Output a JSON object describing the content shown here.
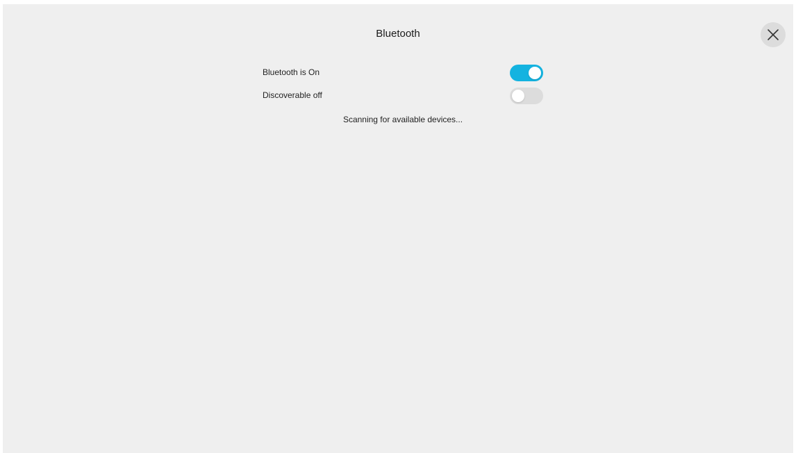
{
  "dialog": {
    "title": "Bluetooth",
    "close_icon": "close-icon"
  },
  "settings": [
    {
      "label": "Bluetooth is On",
      "enabled": true
    },
    {
      "label": "Discoverable off",
      "enabled": false
    }
  ],
  "status": {
    "text": "Scanning for available devices..."
  },
  "colors": {
    "accent": "#14b3e0",
    "toggle_off": "#dcdcdc",
    "background": "#efefef"
  }
}
